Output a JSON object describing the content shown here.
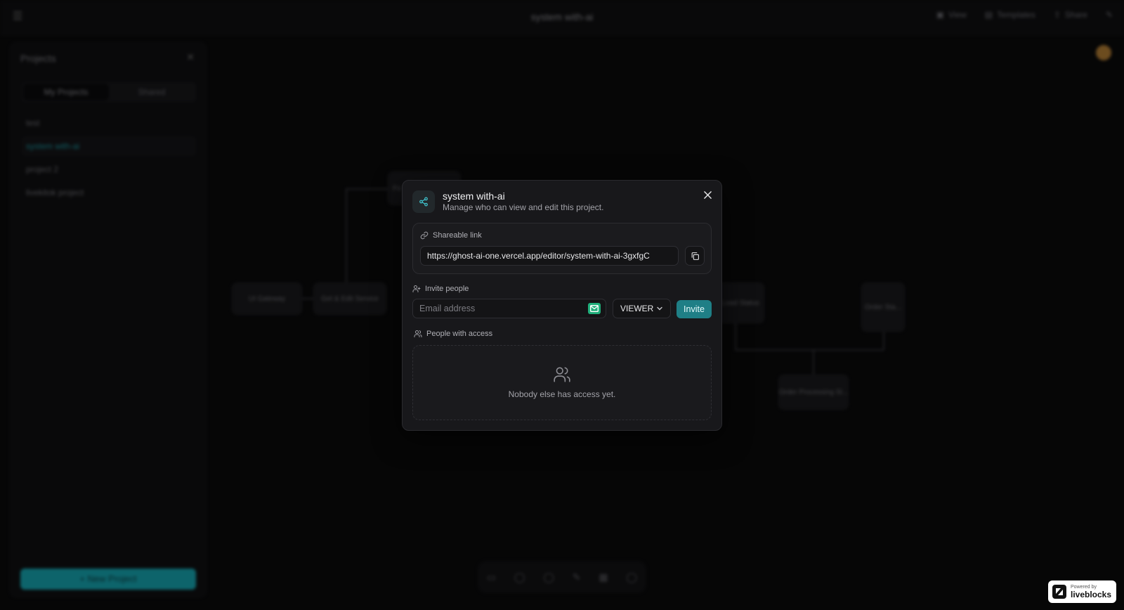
{
  "background": {
    "topbar": {
      "title": "system with-ai",
      "actions": [
        "View",
        "Templates",
        "Share"
      ]
    },
    "sidebar": {
      "title": "Projects",
      "tabs": [
        "My Projects",
        "Shared"
      ],
      "items": [
        "test",
        "system with-ai",
        "project 2",
        "livekitok project"
      ],
      "new_button": "+ New Project"
    },
    "nodes": [
      "UI Gateway",
      "Get & Edit Service",
      "Fo",
      "Load Status",
      "Order Sta...",
      "Order Processing Sl..."
    ]
  },
  "modal": {
    "title": "system with-ai",
    "subtitle": "Manage who can view and edit this project.",
    "shareable_link": {
      "label": "Shareable link",
      "url": "https://ghost-ai-one.vercel.app/editor/system-with-ai-3gxfgC"
    },
    "invite": {
      "label": "Invite people",
      "email_placeholder": "Email address",
      "role": "VIEWER",
      "button": "Invite"
    },
    "access": {
      "label": "People with access",
      "empty_text": "Nobody else has access yet."
    }
  },
  "liveblocks": {
    "powered_by": "Powered by",
    "name": "liveblocks"
  },
  "colors": {
    "accent": "#1f7f86",
    "brand_cyan": "#19b7c4"
  }
}
